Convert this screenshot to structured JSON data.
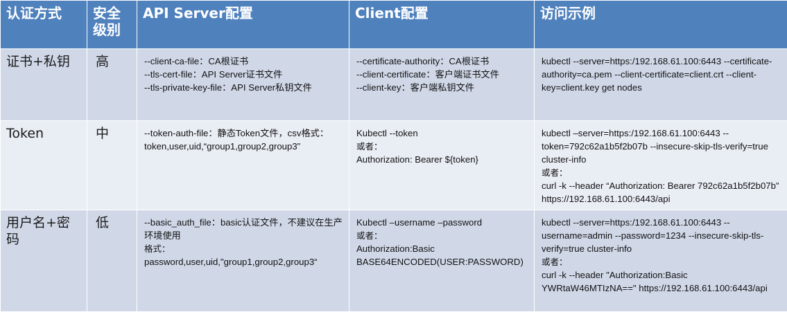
{
  "headers": {
    "method": "认证方式",
    "level": "安全级别",
    "server": "API Server配置",
    "client": "Client配置",
    "example": "访问示例"
  },
  "rows": [
    {
      "method": "证书+私钥",
      "level": "高",
      "server": [
        "--client-ca-file：CA根证书",
        "--tls-cert-file：API Server证书文件",
        "--tls-private-key-file：API Server私钥文件"
      ],
      "client": [
        "--certificate-authority：CA根证书",
        "--client-certificate：客户端证书文件",
        "--client-key：客户端私钥文件"
      ],
      "example": [
        "kubectl --server=https:/192.168.61.100:6443 --certificate-authority=ca.pem  --client-certificate=client.crt  --client-key=client.key  get nodes"
      ]
    },
    {
      "method": "Token",
      "level": "中",
      "server": [
        "--token-auth-file：静态Token文件，csv格式：",
        "token,user,uid,“group1,group2,group3”"
      ],
      "client": [
        "Kubectl --token",
        "或者：",
        "Authorization: Bearer ${token}"
      ],
      "example": [
        "kubectl –server=https:/192.168.61.100:6443 --token=792c62a1b5f2b07b  --insecure-skip-tls-verify=true  cluster-info",
        "或者：",
        "curl -k --header “Authorization: Bearer 792c62a1b5f2b07b” https://192.168.61.100:6443/api"
      ]
    },
    {
      "method": "用户名+密码",
      "level": "低",
      "server": [
        "--basic_auth_file：basic认证文件，不建议在生产环境使用",
        "格式：",
        "password,user,uid,\"group1,group2,group3“"
      ],
      "client": [
        "Kubectl –username –password",
        "或者：",
        "Authorization:Basic BASE64ENCODED(USER:PASSWORD)"
      ],
      "example": [
        "kubectl --server=https:/192.168.61.100:6443 --username=admin  --password=1234  --insecure-skip-tls-verify=true  cluster-info",
        "或者：",
        "curl -k --header \"Authorization:Basic YWRtaW46MTIzNA==\" https://192.168.61.100:6443/api"
      ]
    }
  ]
}
